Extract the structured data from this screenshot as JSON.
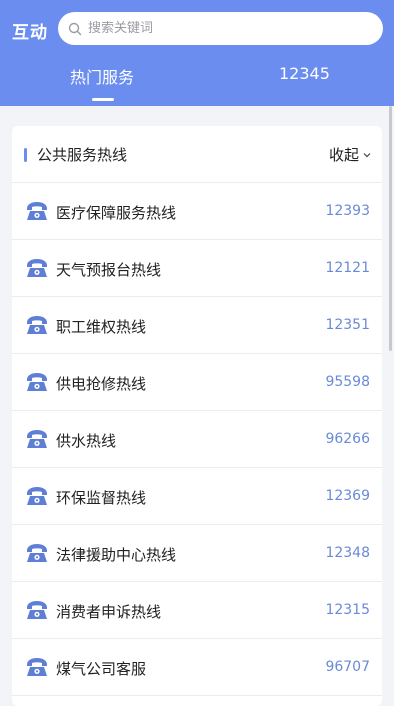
{
  "header": {
    "title": "互动",
    "search_placeholder": "搜索关键词",
    "tabs": [
      {
        "label": "热门服务",
        "active": true
      },
      {
        "label": "12345",
        "active": false
      }
    ],
    "background_color": "#6b8df0"
  },
  "section": {
    "title": "公共服务热线",
    "collapse_label": "收起",
    "accent_color": "#6b8df0",
    "number_color": "#6a8ad8",
    "hotlines": [
      {
        "name": "医疗保障服务热线",
        "number": "12393",
        "icon": "telephone-icon"
      },
      {
        "name": "天气预报台热线",
        "number": "12121",
        "icon": "telephone-icon"
      },
      {
        "name": "职工维权热线",
        "number": "12351",
        "icon": "telephone-icon"
      },
      {
        "name": "供电抢修热线",
        "number": "95598",
        "icon": "telephone-icon"
      },
      {
        "name": "供水热线",
        "number": "96266",
        "icon": "telephone-icon"
      },
      {
        "name": "环保监督热线",
        "number": "12369",
        "icon": "telephone-icon"
      },
      {
        "name": "法律援助中心热线",
        "number": "12348",
        "icon": "telephone-icon"
      },
      {
        "name": "消费者申诉热线",
        "number": "12315",
        "icon": "telephone-icon"
      },
      {
        "name": "煤气公司客服",
        "number": "96707",
        "icon": "telephone-icon"
      }
    ]
  }
}
